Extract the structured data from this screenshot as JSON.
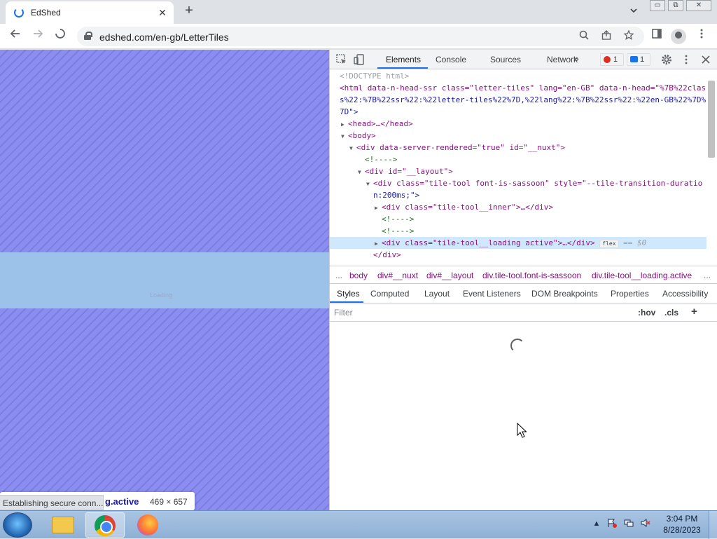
{
  "browser": {
    "tab_title": "EdShed",
    "tab_close": "✕",
    "new_tab": "+",
    "url": "edshed.com/en-gb/LetterTiles",
    "window_min": "▭",
    "window_max": "⧉",
    "window_close": "✕"
  },
  "page": {
    "loading_text": "Loading",
    "tooltip_label": "g.active",
    "tooltip_size": "469 × 657",
    "status": "Establishing secure conn..."
  },
  "devtools": {
    "tabs": [
      "Elements",
      "Console",
      "Sources",
      "Network"
    ],
    "more_tabs": "»",
    "error_count": "1",
    "message_count": "1",
    "dom_lines": [
      {
        "kind": "doctype",
        "text": "<!DOCTYPE html>"
      },
      {
        "kind": "tag",
        "text": "<html data-n-head-ssr class=\"letter-tiles\" lang=\"en-GB\" data-n-head=\"%7B%22clas"
      },
      {
        "kind": "cont",
        "text": "s%22:%7B%22ssr%22:%22letter-tiles%22%7D,%22lang%22:%7B%22ssr%22:%22en-GB%22%7D%"
      },
      {
        "kind": "cont",
        "text": "7D\">"
      },
      {
        "kind": "tag",
        "text": "<head>…</head>"
      },
      {
        "kind": "tag",
        "text": "<body>"
      },
      {
        "kind": "tag",
        "text": "<div data-server-rendered=\"true\" id=\"__nuxt\">"
      },
      {
        "kind": "comment",
        "text": "<!---->"
      },
      {
        "kind": "tag",
        "text": "<div id=\"__layout\">"
      },
      {
        "kind": "tag",
        "text": "<div class=\"tile-tool font-is-sassoon\" style=\"--tile-transition-duratio"
      },
      {
        "kind": "cont",
        "text": "n:200ms;\">"
      },
      {
        "kind": "tag",
        "text": "<div class=\"tile-tool__inner\">…</div>"
      },
      {
        "kind": "comment",
        "text": "<!---->"
      },
      {
        "kind": "comment",
        "text": "<!---->"
      },
      {
        "kind": "tag",
        "text": "<div class=\"tile-tool__loading active\">…</div>"
      },
      {
        "kind": "tag",
        "text": "</div>"
      }
    ],
    "selected_badge": "flex",
    "selected_ref": "== $0",
    "breadcrumbs": [
      "...",
      "body",
      "div#__nuxt",
      "div#__layout",
      "div.tile-tool.font-is-sassoon",
      "div.tile-tool__loading.active",
      "..."
    ],
    "styles_tabs": [
      "Styles",
      "Computed",
      "Layout",
      "Event Listeners",
      "DOM Breakpoints",
      "Properties",
      "Accessibility"
    ],
    "filter_placeholder": "Filter",
    "hov": ":hov",
    "cls": ".cls",
    "add_rule": "+"
  },
  "taskbar": {
    "time": "3:04 PM",
    "date": "8/28/2023"
  },
  "colors": {
    "page_stripe": "#8b8ef0",
    "loading_band": "#9dc2e9",
    "devtools_accent": "#1a73e8"
  }
}
